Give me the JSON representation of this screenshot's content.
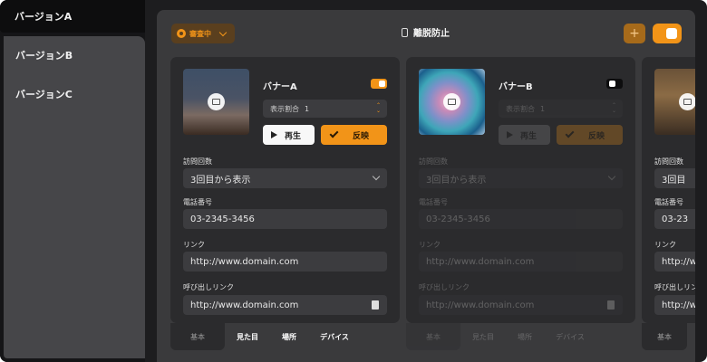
{
  "sidebar": {
    "items": [
      {
        "label": "バージョンA",
        "active": true
      },
      {
        "label": "バージョンB",
        "active": false
      },
      {
        "label": "バージョンC",
        "active": false
      }
    ]
  },
  "header": {
    "status_label": "審査中",
    "title": "離脱防止",
    "add_label": "+"
  },
  "cards": [
    {
      "name": "バナーA",
      "enabled": true,
      "ratio_label": "表示割合",
      "ratio_value": "1",
      "play_label": "再生",
      "apply_label": "反映",
      "visits_label": "訪問回数",
      "visits_value": "3回目から表示",
      "phone_label": "電話番号",
      "phone_value": "03-2345-3456",
      "link_label": "リンク",
      "link_value": "http://www.domain.com",
      "call_link_label": "呼び出しリンク",
      "call_link_value": "http://www.domain.com",
      "tabs": [
        "基本",
        "見た目",
        "場所",
        "デバイス"
      ]
    },
    {
      "name": "バナーB",
      "enabled": false,
      "ratio_label": "表示割合",
      "ratio_value": "1",
      "play_label": "再生",
      "apply_label": "反映",
      "visits_label": "訪問回数",
      "visits_value": "3回目から表示",
      "phone_label": "電話番号",
      "phone_value": "03-2345-3456",
      "link_label": "リンク",
      "link_value": "http://www.domain.com",
      "call_link_label": "呼び出しリンク",
      "call_link_value": "http://www.domain.com",
      "tabs": [
        "基本",
        "見た目",
        "場所",
        "デバイス"
      ]
    },
    {
      "visits_label": "訪問回数",
      "visits_value": "3回目",
      "phone_label": "電話番号",
      "phone_value": "03-23",
      "link_label": "リンク",
      "link_value": "http://w",
      "call_link_label": "呼び出しリン",
      "call_link_value": "http://w",
      "tabs": [
        "基本"
      ]
    }
  ],
  "colors": {
    "accent": "#f29418",
    "background": "#1d1d1f",
    "panel": "#3a3a3c",
    "card": "#2b2b2d"
  }
}
